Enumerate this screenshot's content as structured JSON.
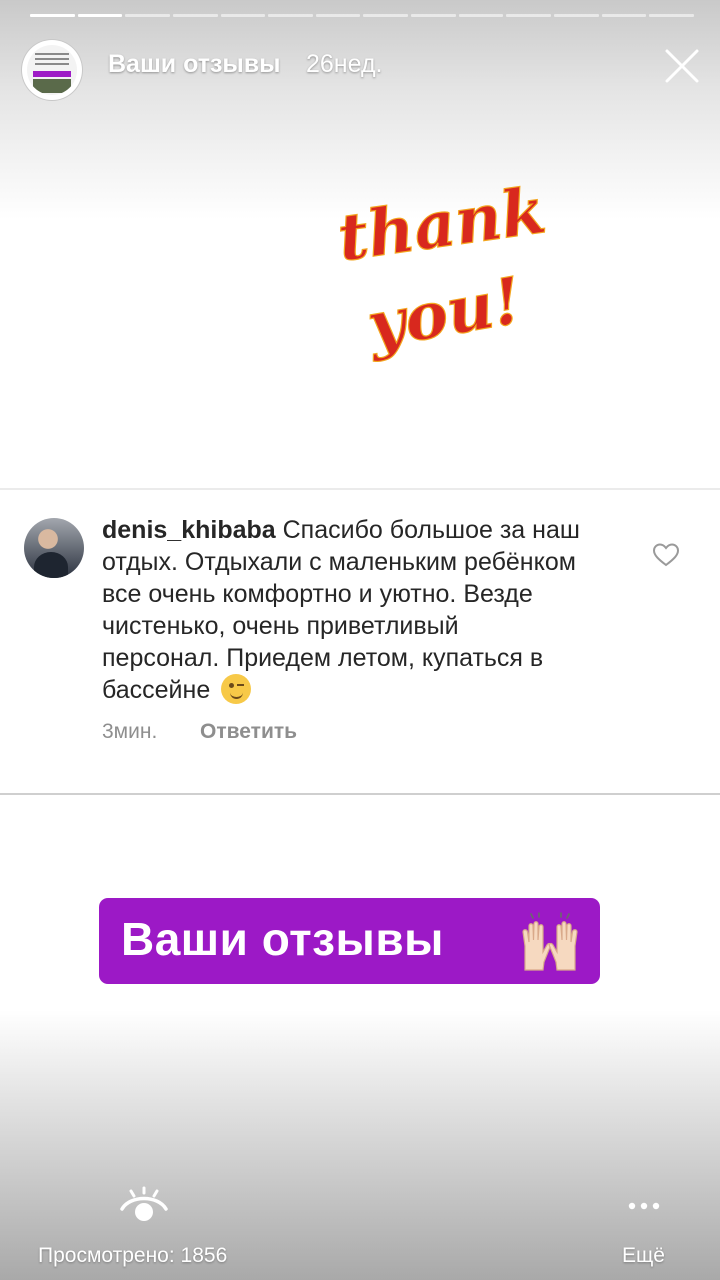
{
  "story": {
    "title": "Ваши отзывы",
    "time_ago": "26нед.",
    "segments_total": 14,
    "segments_viewed": 2
  },
  "image": {
    "line1": "thank",
    "line2": "you!",
    "color": "#d8281e"
  },
  "comment": {
    "username": "denis_khibaba",
    "text": " Спасибо большое за наш отдых. Отдыхали с маленьким ребёнком все очень комфортно и уютно. Везде чистенько, очень приветливый персонал. Приедем летом, купаться в бассейне",
    "emoji": "winking-face",
    "time": "3мин.",
    "reply_label": "Ответить"
  },
  "banner": {
    "text": "Ваши отзывы",
    "emoji": "raising-hands",
    "color": "#9c19c6"
  },
  "footer": {
    "views_label": "Просмотрено: 1856",
    "more_label": "Ещё"
  }
}
